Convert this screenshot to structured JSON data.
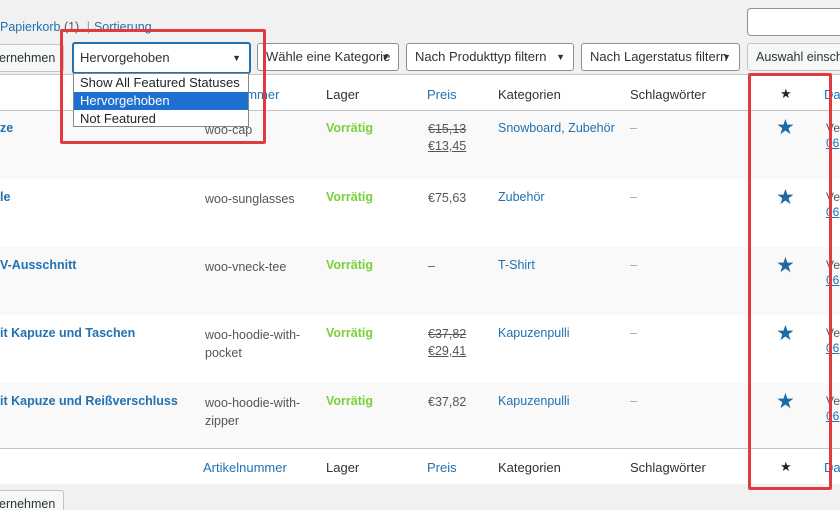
{
  "subsubsub": {
    "trash": "Papierkorb",
    "trash_count": "(1)",
    "separator": "|",
    "sorting": "Sortierung"
  },
  "toolbar": {
    "bulk_apply": "ernehmen",
    "featured_selected": "Hervorgehoben",
    "category_filter": "Wähle eine Kategorie",
    "product_type_filter": "Nach Produkttyp filtern",
    "stock_status_filter": "Nach Lagerstatus filtern",
    "limit_button": "Auswahl einschrä"
  },
  "featured_dropdown": {
    "options": [
      "Show All Featured Statuses",
      "Hervorgehoben",
      "Not Featured"
    ],
    "selected_index": 1
  },
  "columns": {
    "sku": "ummer",
    "sku_footer": "Artikelnummer",
    "stock": "Lager",
    "price": "Preis",
    "categories": "Kategorien",
    "tags": "Schlagwörter",
    "featured_star": "★",
    "date": "Da"
  },
  "rows": [
    {
      "name": "ze",
      "sku_line1": "woo-cap",
      "sku_line2": "",
      "stock": "Vorrätig",
      "price_old": "€15,13",
      "price_new": "€13,45",
      "price": "",
      "categories": "Snowboard, Zubehör",
      "tags": "–",
      "star": "★",
      "date_line1": "Ve",
      "date_line2": "06"
    },
    {
      "name": "le",
      "sku_line1": "woo-sunglasses",
      "sku_line2": "",
      "stock": "Vorrätig",
      "price_old": "",
      "price_new": "",
      "price": "€75,63",
      "categories": "Zubehör",
      "tags": "–",
      "star": "★",
      "date_line1": "Ve",
      "date_line2": "06"
    },
    {
      "name": "V-Ausschnitt",
      "sku_line1": "woo-vneck-tee",
      "sku_line2": "",
      "stock": "Vorrätig",
      "price_old": "",
      "price_new": "",
      "price": "–",
      "categories": "T-Shirt",
      "tags": "–",
      "star": "★",
      "date_line1": "Ve",
      "date_line2": "06"
    },
    {
      "name": "it Kapuze und Taschen",
      "sku_line1": "woo-hoodie-with-",
      "sku_line2": "pocket",
      "stock": "Vorrätig",
      "price_old": "€37,82",
      "price_new": "€29,41",
      "price": "",
      "categories": "Kapuzenpulli",
      "tags": "–",
      "star": "★",
      "date_line1": "Ve",
      "date_line2": "06"
    },
    {
      "name": "it Kapuze und Reißverschluss",
      "sku_line1": "woo-hoodie-with-",
      "sku_line2": "zipper",
      "stock": "Vorrätig",
      "price_old": "",
      "price_new": "",
      "price": "€37,82",
      "categories": "Kapuzenpulli",
      "tags": "–",
      "star": "★",
      "date_line1": "Ve",
      "date_line2": "06"
    }
  ],
  "bottom_toolbar": {
    "bulk_apply": "ernehmen"
  },
  "colors": {
    "link": "#2271b1",
    "in_stock": "#7ad03a",
    "featured_star": "#1e6aa5",
    "highlight_box": "#e03a3e",
    "dropdown_selected": "#1f6fd0"
  }
}
